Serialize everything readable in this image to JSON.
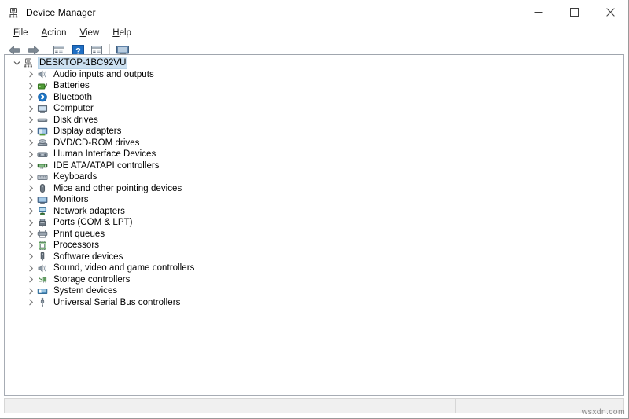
{
  "window": {
    "title": "Device Manager",
    "app_icon": "device-manager-icon",
    "controls": {
      "minimize": "minimize-icon",
      "maximize": "maximize-icon",
      "close": "close-icon"
    }
  },
  "menubar": {
    "items": [
      {
        "label": "File",
        "accesskey": "F"
      },
      {
        "label": "Action",
        "accesskey": "A"
      },
      {
        "label": "View",
        "accesskey": "V"
      },
      {
        "label": "Help",
        "accesskey": "H"
      }
    ]
  },
  "toolbar": {
    "buttons": [
      {
        "icon": "back-arrow-icon",
        "label": "Back"
      },
      {
        "icon": "forward-arrow-icon",
        "label": "Forward"
      },
      {
        "icon": "separator",
        "label": ""
      },
      {
        "icon": "show-hidden-devices-icon",
        "label": "Show hidden devices"
      },
      {
        "icon": "help-icon",
        "label": "Help"
      },
      {
        "icon": "properties-icon",
        "label": "Properties"
      },
      {
        "icon": "separator",
        "label": ""
      },
      {
        "icon": "scan-for-hardware-changes-icon",
        "label": "Scan for hardware changes"
      }
    ]
  },
  "tree": {
    "root": {
      "label": "DESKTOP-1BC92VU",
      "icon": "computer-root-icon",
      "expanded": true,
      "selected": true
    },
    "children": [
      {
        "label": "Audio inputs and outputs",
        "icon": "speaker-icon"
      },
      {
        "label": "Batteries",
        "icon": "battery-icon"
      },
      {
        "label": "Bluetooth",
        "icon": "bluetooth-icon"
      },
      {
        "label": "Computer",
        "icon": "monitor-icon"
      },
      {
        "label": "Disk drives",
        "icon": "disk-drive-icon"
      },
      {
        "label": "Display adapters",
        "icon": "display-adapter-icon"
      },
      {
        "label": "DVD/CD-ROM drives",
        "icon": "optical-drive-icon"
      },
      {
        "label": "Human Interface Devices",
        "icon": "hid-icon"
      },
      {
        "label": "IDE ATA/ATAPI controllers",
        "icon": "ide-controller-icon"
      },
      {
        "label": "Keyboards",
        "icon": "keyboard-icon"
      },
      {
        "label": "Mice and other pointing devices",
        "icon": "mouse-icon"
      },
      {
        "label": "Monitors",
        "icon": "monitor-screen-icon"
      },
      {
        "label": "Network adapters",
        "icon": "network-adapter-icon"
      },
      {
        "label": "Ports (COM & LPT)",
        "icon": "port-icon"
      },
      {
        "label": "Print queues",
        "icon": "printer-icon"
      },
      {
        "label": "Processors",
        "icon": "processor-icon"
      },
      {
        "label": "Software devices",
        "icon": "software-device-icon"
      },
      {
        "label": "Sound, video and game controllers",
        "icon": "sound-controller-icon"
      },
      {
        "label": "Storage controllers",
        "icon": "storage-controller-icon"
      },
      {
        "label": "System devices",
        "icon": "system-device-icon"
      },
      {
        "label": "Universal Serial Bus controllers",
        "icon": "usb-controller-icon"
      }
    ]
  },
  "statusbar": {
    "main_text": "",
    "pane_two_text": "",
    "pane_three_text": ""
  },
  "watermark": {
    "text": "wsxdn.com"
  },
  "colors": {
    "selection_bg": "#cce0f0",
    "selection_border": "#b5d2e8",
    "panel_border": "#a7acb4",
    "statusbar_bg": "#f0f0f0",
    "chevron": "#767676"
  }
}
